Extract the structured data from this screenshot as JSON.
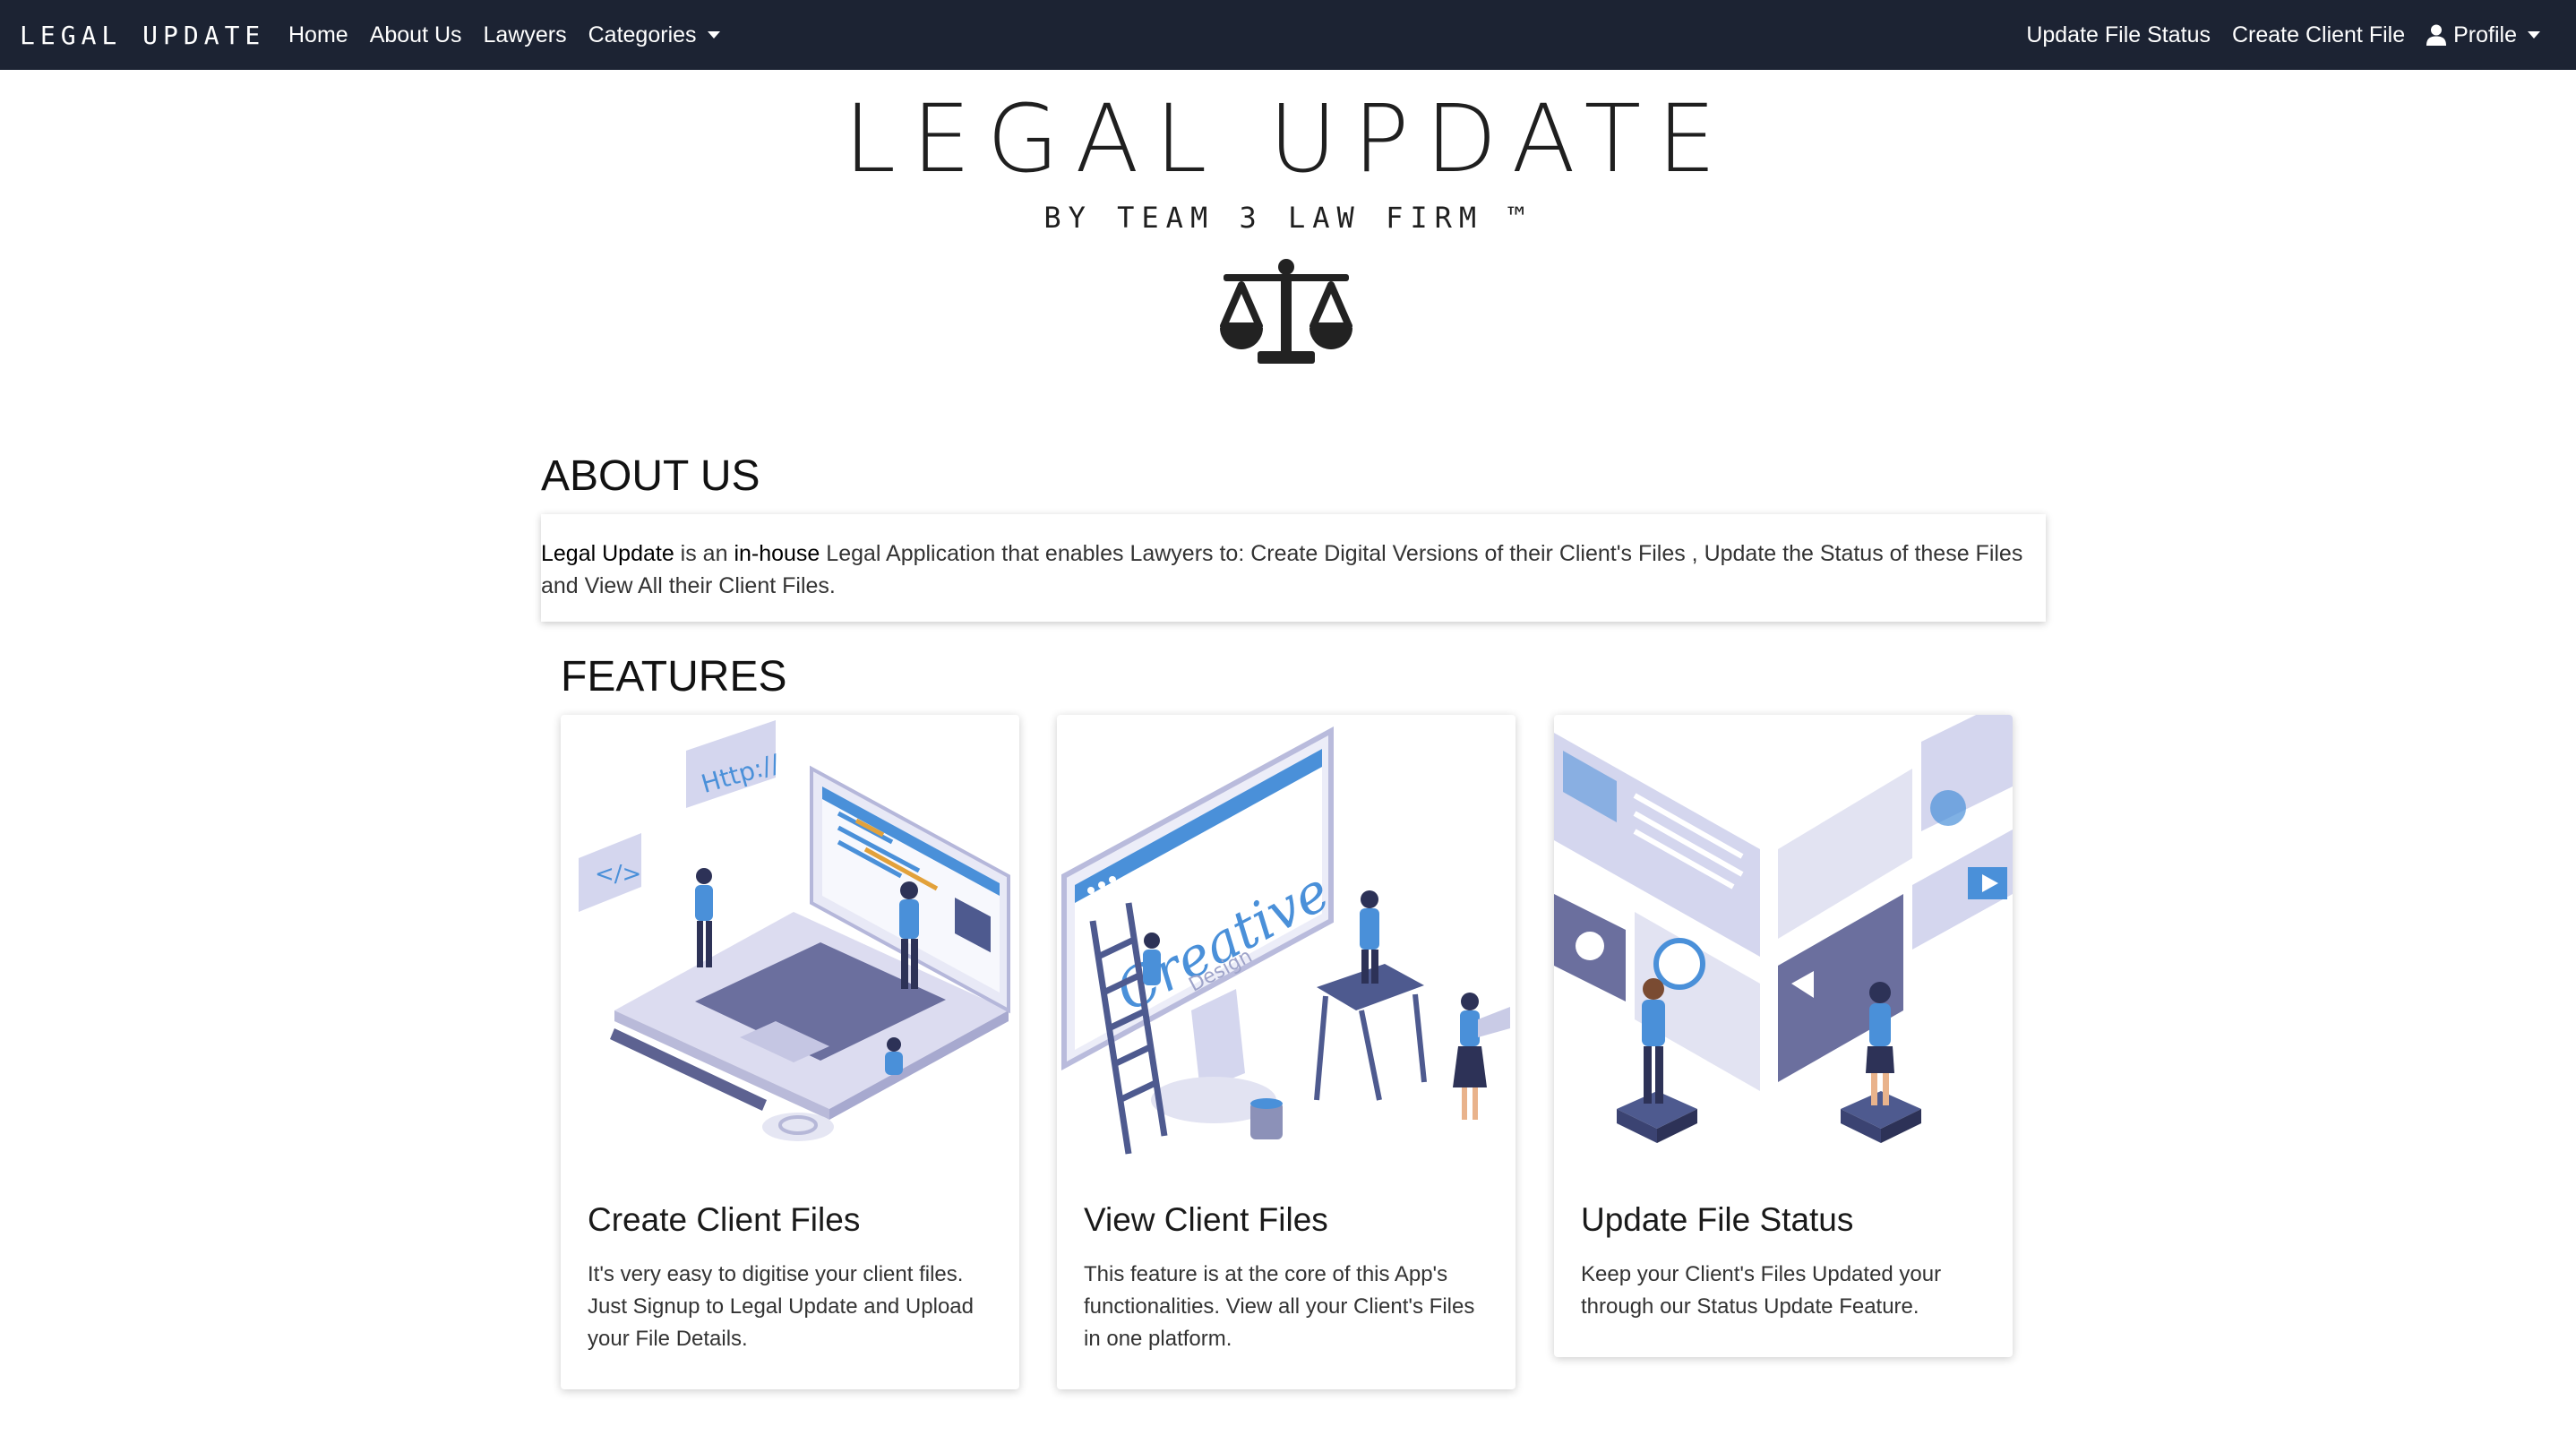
{
  "navbar": {
    "brand": "LEGAL UPDATE",
    "links": [
      {
        "label": "Home"
      },
      {
        "label": "About Us"
      },
      {
        "label": "Lawyers"
      },
      {
        "label": "Categories"
      }
    ],
    "right_links": [
      {
        "label": "Update File Status"
      },
      {
        "label": "Create Client File"
      },
      {
        "label": "Profile"
      }
    ]
  },
  "hero": {
    "title": "LEGAL UPDATE",
    "subtitle": "BY TEAM 3 LAW FIRM ™"
  },
  "about": {
    "heading": "ABOUT US",
    "strong1": "Legal Update",
    "text1": " is an ",
    "strong2": "in-house",
    "text2": " Legal Application that enables Lawyers to: Create Digital Versions of their Client's Files , Update the Status of these Files and View All their Client Files."
  },
  "features": {
    "heading": "FEATURES",
    "cards": [
      {
        "title": "Create Client Files",
        "text": "It's very easy to digitise your client files. Just Signup to Legal Update and Upload your File Details."
      },
      {
        "title": "View Client Files",
        "text": "This feature is at the core of this App's functionalities. View all your Client's Files in one platform."
      },
      {
        "title": "Update File Status",
        "text": "Keep your Client's Files Updated your through our Status Update Feature."
      }
    ]
  },
  "colors": {
    "navbar_bg": "#1c2333",
    "accent_blue": "#4a90d9",
    "illustration_lilac": "#c9cbe6"
  }
}
